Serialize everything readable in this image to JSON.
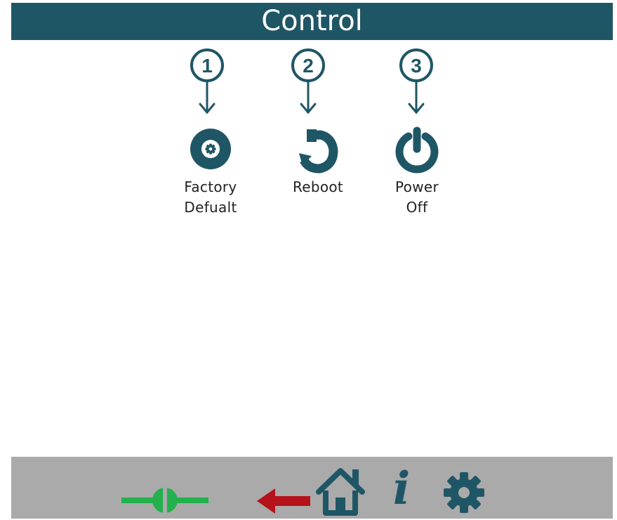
{
  "header": {
    "title": "Control"
  },
  "annotations": [
    "1",
    "2",
    "3"
  ],
  "controls": [
    {
      "label_line1": "Factory",
      "label_line2": "Defualt",
      "icon": "factory-default-icon"
    },
    {
      "label_line1": "Reboot",
      "label_line2": "",
      "icon": "reboot-icon"
    },
    {
      "label_line1": "Power",
      "label_line2": "Off",
      "icon": "power-icon"
    }
  ],
  "footer": {
    "icons": [
      "connection-icon",
      "back-arrow-icon",
      "home-icon",
      "info-icon",
      "settings-gear-icon"
    ],
    "info_glyph": "i"
  },
  "colors": {
    "primary": "#1f5666",
    "footer_bg": "#aaaaaa",
    "connection": "#22b14c",
    "back_arrow": "#b5121b"
  }
}
